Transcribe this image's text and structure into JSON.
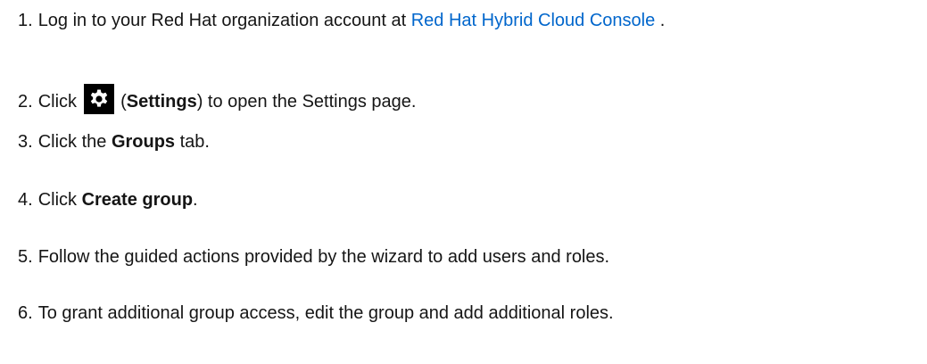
{
  "steps": [
    {
      "num": "1.",
      "before": "Log in to your Red Hat organization account at ",
      "link": "Red Hat Hybrid Cloud Console",
      "after": " ."
    },
    {
      "num": "2.",
      "before": "Click ",
      "icon": "gear-icon",
      "paren_open": " (",
      "term": "Settings",
      "after": ") to open the Settings page."
    },
    {
      "num": "3.",
      "before": "Click the ",
      "term": "Groups",
      "after": " tab."
    },
    {
      "num": "4.",
      "before": "Click ",
      "term": "Create group",
      "after": "."
    },
    {
      "num": "5.",
      "text": "Follow the guided actions provided by the wizard to add users and roles."
    },
    {
      "num": "6.",
      "text": "To grant additional group access, edit the group and add additional roles."
    }
  ],
  "colors": {
    "text": "#151515",
    "link": "#0066cc",
    "icon_background": "#000000",
    "icon_foreground": "#ffffff"
  }
}
